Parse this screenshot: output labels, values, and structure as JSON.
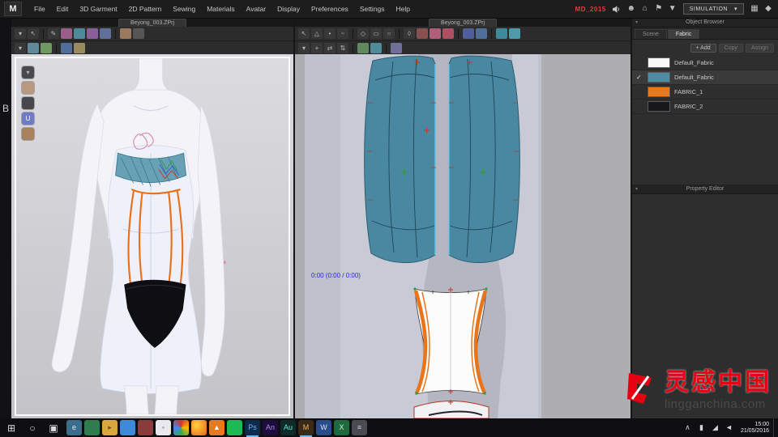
{
  "menu": {
    "logo": "M",
    "items": [
      "File",
      "Edit",
      "3D Garment",
      "2D Pattern",
      "Sewing",
      "Materials",
      "Avatar",
      "Display",
      "Preferences",
      "Settings",
      "Help"
    ],
    "version_label": "MD_2015",
    "simulation_button": "SIMULATION",
    "caret": "▾"
  },
  "panels": {
    "view3d": {
      "tab": "Beyong_003.ZPrj"
    },
    "view2d": {
      "tab": "Beyong_003.ZPrj",
      "timecode": "0:00 (0:00 / 0:00)"
    }
  },
  "side_window": {
    "label": "B"
  },
  "object_browser": {
    "title": "Object Browser",
    "tabs": [
      "Scene",
      "Fabric"
    ],
    "buttons": {
      "add": "+ Add",
      "copy": "Copy",
      "assign": "Assign"
    },
    "check_glyph": "✓",
    "panel_arrow": "▾",
    "fabrics": [
      {
        "name": "Default_Fabric",
        "color": "#f8f8f8"
      },
      {
        "name": "Default_Fabric",
        "color": "#4d8ca3"
      },
      {
        "name": "FABRIC_1",
        "color": "#e8791c"
      },
      {
        "name": "FABRIC_2",
        "color": "#17171b"
      }
    ],
    "property_editor_title": "Property Editor"
  },
  "icons": {
    "menu_right": [
      {
        "n": "user-icon",
        "g": "☻"
      },
      {
        "n": "display-mode-icon",
        "g": "⌂"
      },
      {
        "n": "notification-icon",
        "g": "⚑"
      },
      {
        "n": "download-icon",
        "g": "▼"
      }
    ],
    "menu_far_right": [
      {
        "n": "layout-grid-icon",
        "g": "▦"
      },
      {
        "n": "pin-icon",
        "g": "◆"
      }
    ],
    "view3d_row1": [
      {
        "n": "simulate-dropdown-icon",
        "g": "▾",
        "c": "#383838"
      },
      {
        "n": "select-move-tool",
        "g": "↖",
        "c": "#383838"
      },
      {
        "n": "separator"
      },
      {
        "n": "pen-3d-tool",
        "g": "✎",
        "c": "#383838"
      },
      {
        "n": "sewing-display-toggle",
        "c": "#9a5f86"
      },
      {
        "n": "fabric-display-toggle",
        "c": "#4f8a9a"
      },
      {
        "n": "pattern-display-toggle",
        "c": "#8a5f9a"
      },
      {
        "n": "mesh-display-toggle",
        "c": "#5f6f9a"
      },
      {
        "n": "separator"
      },
      {
        "n": "avatar-display-toggle",
        "c": "#9a7a5f"
      },
      {
        "n": "bounding-volume-toggle",
        "c": "#565656"
      }
    ],
    "view3d_row2": [
      {
        "n": "gizmo-dropdown-icon",
        "g": "▾",
        "c": "#383838"
      },
      {
        "n": "show-garment-toggle",
        "c": "#5f8a9a"
      },
      {
        "n": "show-avatar-toggle",
        "c": "#6f9a5f"
      },
      {
        "n": "separator"
      },
      {
        "n": "render-style-toggle",
        "c": "#4f6f9a"
      },
      {
        "n": "show-wireframe-toggle",
        "c": "#9a8a5f"
      }
    ],
    "view2d_row1": [
      {
        "n": "transform-pattern-tool",
        "g": "↖",
        "c": "#383838"
      },
      {
        "n": "edit-pattern-tool",
        "g": "△",
        "c": "#383838"
      },
      {
        "n": "edit-point-tool",
        "g": "•",
        "c": "#383838"
      },
      {
        "n": "edit-curvature-tool",
        "g": "~",
        "c": "#383838"
      },
      {
        "n": "separator"
      },
      {
        "n": "polygon-tool",
        "g": "◇",
        "c": "#383838"
      },
      {
        "n": "rectangle-tool",
        "g": "▭",
        "c": "#383838"
      },
      {
        "n": "circle-tool",
        "g": "○",
        "c": "#383838"
      },
      {
        "n": "separator"
      },
      {
        "n": "dart-tool",
        "g": "◊",
        "c": "#383838"
      },
      {
        "n": "notch-tool",
        "c": "#8a4f4f"
      },
      {
        "n": "seam-tool",
        "c": "#b05f7a"
      },
      {
        "n": "tack-tool",
        "c": "#b04f5f"
      },
      {
        "n": "separator"
      },
      {
        "n": "internal-rectangle-tool",
        "c": "#4f5f9a"
      },
      {
        "n": "internal-circle-tool",
        "c": "#4f6f9a"
      },
      {
        "n": "separator"
      },
      {
        "n": "show-texture-toggle",
        "c": "#3f8a9a"
      },
      {
        "n": "show-grid-toggle",
        "c": "#4f9aaa"
      }
    ],
    "view2d_row2": [
      {
        "n": "pattern-outline-dropdown-icon",
        "g": "▾",
        "c": "#383838"
      },
      {
        "n": "move-pattern-tool",
        "g": "+",
        "c": "#383838"
      },
      {
        "n": "flip-horizontal-tool",
        "g": "⇄",
        "c": "#383838"
      },
      {
        "n": "flip-vertical-tool",
        "g": "⇅",
        "c": "#383838"
      },
      {
        "n": "separator"
      },
      {
        "n": "grading-toggle",
        "c": "#5f8a5f"
      },
      {
        "n": "show-baseline-toggle",
        "c": "#4f8a9a"
      },
      {
        "n": "separator"
      },
      {
        "n": "sync-2d3d-toggle",
        "c": "#6f6f9a"
      }
    ],
    "avatar_toggles": [
      {
        "n": "camera-view-icon",
        "g": "▾",
        "c": "#4a4a4e"
      },
      {
        "n": "avatar-head-icon",
        "c": "#b8987f"
      },
      {
        "n": "avatar-hair-icon",
        "c": "#46464c"
      },
      {
        "n": "avatar-underwear-icon",
        "g": "U",
        "c": "#6f7ac8",
        "fg": "#ffffff"
      },
      {
        "n": "avatar-shoes-icon",
        "c": "#a8825f"
      }
    ],
    "taskbar_apps": [
      {
        "n": "app-edge",
        "g": "e",
        "c": "#3c6d8a",
        "fg": "#cfe8ff"
      },
      {
        "n": "app-store",
        "c": "#2f7d4f"
      },
      {
        "n": "app-file-explorer",
        "g": "▸",
        "c": "#d8a83c",
        "fg": "#6d4f1c"
      },
      {
        "n": "app-photos",
        "c": "#3c8ad8"
      },
      {
        "n": "app-mail",
        "c": "#8a3c3c"
      },
      {
        "n": "app-media-player",
        "g": "◦",
        "c": "#e8e8ee",
        "fg": "#333333"
      },
      {
        "n": "app-chrome",
        "c": "conic-gradient(#d93025,#fbbc04,#34a853,#4285f4,#d93025)"
      },
      {
        "n": "app-firefox",
        "c": "radial-gradient(circle at 35% 35%, #ffd23c, #e8641c)"
      },
      {
        "n": "app-vlc",
        "g": "▲",
        "c": "#e87a1e",
        "fg": "#ffffff"
      },
      {
        "n": "app-spotify",
        "c": "#1db954"
      },
      {
        "n": "app-photoshop",
        "g": "Ps",
        "c": "#0d2b4d",
        "fg": "#6ab6f0",
        "open": true
      },
      {
        "n": "app-animate",
        "g": "An",
        "c": "#1d0d3d",
        "fg": "#b08ae8"
      },
      {
        "n": "app-audition",
        "g": "Au",
        "c": "#0d2b2b",
        "fg": "#6ae8c8"
      },
      {
        "n": "app-marvelous-designer",
        "g": "M",
        "c": "#3a2a1a",
        "fg": "#e8b64c",
        "open": true
      },
      {
        "n": "app-word",
        "g": "W",
        "c": "#2a4d8a",
        "fg": "#cfe0ff"
      },
      {
        "n": "app-excel",
        "g": "X",
        "c": "#1d6b3c",
        "fg": "#c8f0d8"
      },
      {
        "n": "app-notepad",
        "g": "≡",
        "c": "#4a4a55",
        "fg": "#cccccc"
      }
    ],
    "tray": [
      {
        "n": "tray-chevron-up-icon",
        "g": "∧"
      },
      {
        "n": "tray-battery-icon",
        "g": "▮"
      },
      {
        "n": "tray-wifi-icon",
        "g": "◢"
      },
      {
        "n": "tray-volume-icon",
        "g": "◄"
      }
    ]
  },
  "taskbar": {
    "start_glyph": "⊞",
    "search_glyph": "○",
    "taskview_glyph": "▣",
    "time": "15:00",
    "date": "21/05/2016"
  },
  "watermark": {
    "cn": "灵感中国",
    "en": "lingganchina.com"
  },
  "colors": {
    "accent_orange": "#e8791c",
    "fabric_teal": "#4d8ca3",
    "watermark_red": "#e60012"
  }
}
